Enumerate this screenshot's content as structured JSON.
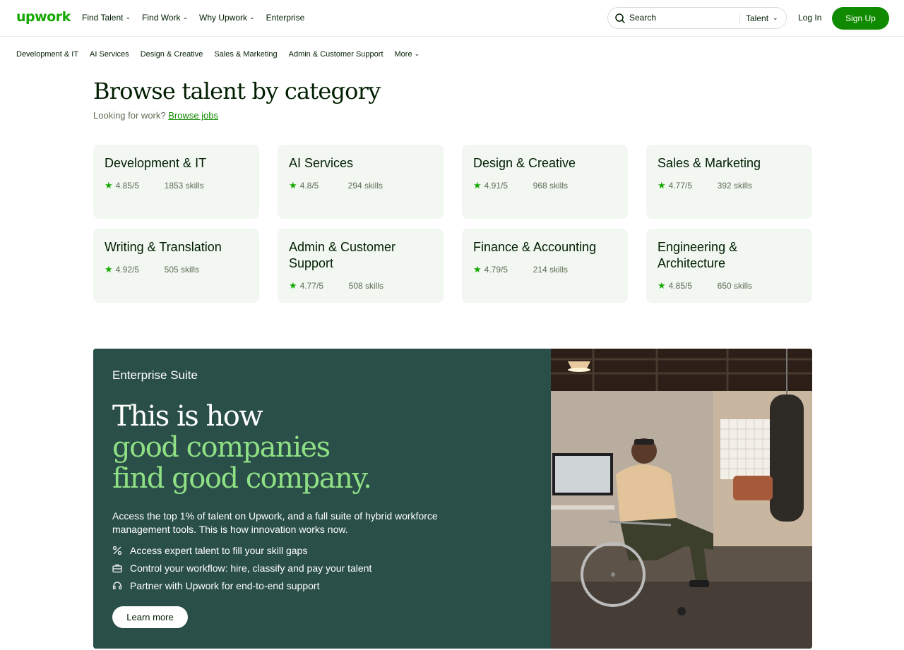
{
  "header": {
    "logo": "upwork",
    "nav": [
      {
        "label": "Find Talent",
        "dropdown": true
      },
      {
        "label": "Find Work",
        "dropdown": true
      },
      {
        "label": "Why Upwork",
        "dropdown": true
      },
      {
        "label": "Enterprise",
        "dropdown": false
      }
    ],
    "search": {
      "placeholder": "Search",
      "scope": "Talent"
    },
    "login": "Log In",
    "signup": "Sign Up"
  },
  "subnav": [
    "Development & IT",
    "AI Services",
    "Design & Creative",
    "Sales & Marketing",
    "Admin & Customer Support",
    "More"
  ],
  "main": {
    "title": "Browse talent by category",
    "subtitle_prefix": "Looking for work?",
    "subtitle_link": "Browse jobs",
    "categories": [
      {
        "name": "Development & IT",
        "rating": "4.85/5",
        "skills": "1853 skills"
      },
      {
        "name": "AI Services",
        "rating": "4.8/5",
        "skills": "294 skills"
      },
      {
        "name": "Design & Creative",
        "rating": "4.91/5",
        "skills": "968 skills"
      },
      {
        "name": "Sales & Marketing",
        "rating": "4.77/5",
        "skills": "392 skills"
      },
      {
        "name": "Writing & Translation",
        "rating": "4.92/5",
        "skills": "505 skills"
      },
      {
        "name": "Admin & Customer Support",
        "rating": "4.77/5",
        "skills": "508 skills"
      },
      {
        "name": "Finance & Accounting",
        "rating": "4.79/5",
        "skills": "214 skills"
      },
      {
        "name": "Engineering & Architecture",
        "rating": "4.85/5",
        "skills": "650 skills"
      }
    ]
  },
  "enterprise": {
    "label": "Enterprise Suite",
    "headline_white": "This is how",
    "headline_green_1": "good companies",
    "headline_green_2": "find good company.",
    "description": "Access the top 1% of talent on Upwork, and a full suite of hybrid workforce management tools. This is how innovation works now.",
    "features": [
      {
        "icon": "percent-icon",
        "text": "Access expert talent to fill your skill gaps"
      },
      {
        "icon": "briefcase-icon",
        "text": "Control your workflow: hire, classify and pay your talent"
      },
      {
        "icon": "headset-icon",
        "text": "Partner with Upwork for end-to-end support"
      }
    ],
    "cta": "Learn more"
  },
  "colors": {
    "brand": "#14a800",
    "button": "#108a00",
    "enterprise_bg": "#2a4f48",
    "accent_text": "#8fdf85",
    "card_bg": "#f2f7f2"
  }
}
